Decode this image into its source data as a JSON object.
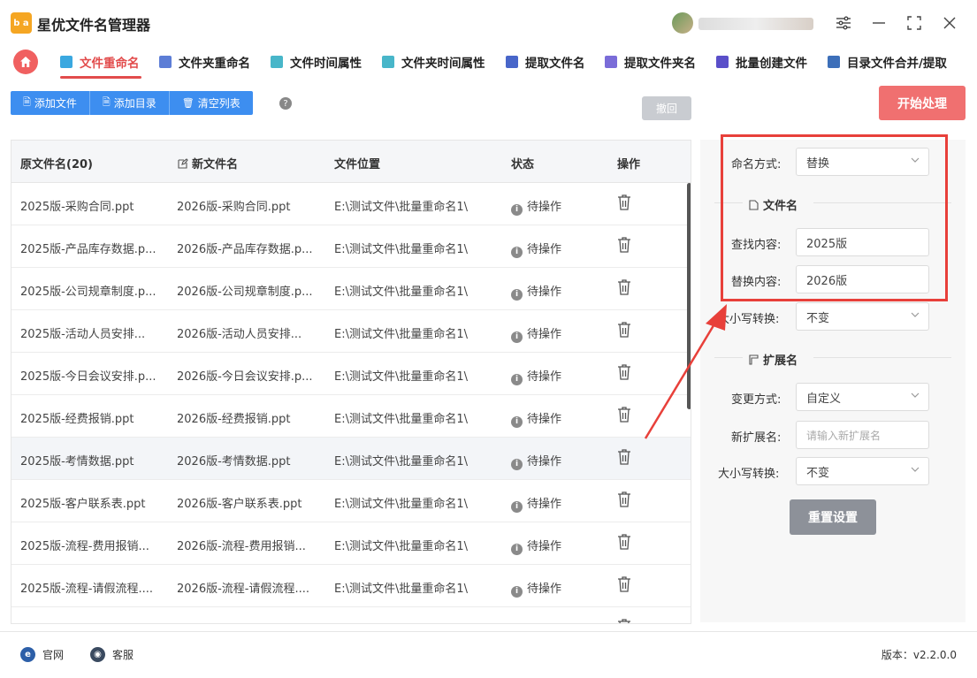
{
  "app": {
    "title": "星优文件名管理器",
    "logo_text": "b a"
  },
  "window_controls": {
    "settings": "☰",
    "minimize": "—",
    "maximize": "⛶",
    "close": "✕"
  },
  "nav": {
    "tabs": [
      {
        "label": "文件重命名",
        "active": true,
        "icon": "file-rename-icon",
        "color": "#3aa8e0"
      },
      {
        "label": "文件夹重命名",
        "active": false,
        "icon": "folder-rename-icon",
        "color": "#5c7dd6"
      },
      {
        "label": "文件时间属性",
        "active": false,
        "icon": "file-time-icon",
        "color": "#48b6c9"
      },
      {
        "label": "文件夹时间属性",
        "active": false,
        "icon": "folder-time-icon",
        "color": "#48b6c9"
      },
      {
        "label": "提取文件名",
        "active": false,
        "icon": "extract-filename-icon",
        "color": "#4866c9"
      },
      {
        "label": "提取文件夹名",
        "active": false,
        "icon": "extract-foldername-icon",
        "color": "#7a6cd8"
      },
      {
        "label": "批量创建文件",
        "active": false,
        "icon": "batch-create-icon",
        "color": "#5a4fc9"
      },
      {
        "label": "目录文件合并/提取",
        "active": false,
        "icon": "merge-extract-icon",
        "color": "#3d6fb9"
      }
    ]
  },
  "toolbar": {
    "add_file": "添加文件",
    "add_dir": "添加目录",
    "clear_list": "清空列表",
    "help": "?",
    "undo": "撤回",
    "start": "开始处理"
  },
  "table": {
    "headers": {
      "original": "原文件名(20)",
      "new": "新文件名",
      "location": "文件位置",
      "status": "状态",
      "action": "操作"
    },
    "rows": [
      {
        "original": "2025版-采购合同.ppt",
        "new": "2026版-采购合同.ppt",
        "location": "E:\\测试文件\\批量重命名1\\",
        "status": "待操作"
      },
      {
        "original": "2025版-产品库存数据.p...",
        "new": "2026版-产品库存数据.p...",
        "location": "E:\\测试文件\\批量重命名1\\",
        "status": "待操作"
      },
      {
        "original": "2025版-公司规章制度.p...",
        "new": "2026版-公司规章制度.p...",
        "location": "E:\\测试文件\\批量重命名1\\",
        "status": "待操作"
      },
      {
        "original": "2025版-活动人员安排...",
        "new": "2026版-活动人员安排...",
        "location": "E:\\测试文件\\批量重命名1\\",
        "status": "待操作"
      },
      {
        "original": "2025版-今日会议安排.p...",
        "new": "2026版-今日会议安排.p...",
        "location": "E:\\测试文件\\批量重命名1\\",
        "status": "待操作"
      },
      {
        "original": "2025版-经费报销.ppt",
        "new": "2026版-经费报销.ppt",
        "location": "E:\\测试文件\\批量重命名1\\",
        "status": "待操作"
      },
      {
        "original": "2025版-考情数据.ppt",
        "new": "2026版-考情数据.ppt",
        "location": "E:\\测试文件\\批量重命名1\\",
        "status": "待操作",
        "highlight": true
      },
      {
        "original": "2025版-客户联系表.ppt",
        "new": "2026版-客户联系表.ppt",
        "location": "E:\\测试文件\\批量重命名1\\",
        "status": "待操作"
      },
      {
        "original": "2025版-流程-费用报销...",
        "new": "2026版-流程-费用报销...",
        "location": "E:\\测试文件\\批量重命名1\\",
        "status": "待操作"
      },
      {
        "original": "2025版-流程-请假流程....",
        "new": "2026版-流程-请假流程....",
        "location": "E:\\测试文件\\批量重命名1\\",
        "status": "待操作"
      },
      {
        "original": "",
        "new": "",
        "location": "",
        "status": ""
      }
    ]
  },
  "panel": {
    "naming_mode_label": "命名方式:",
    "naming_mode_value": "替换",
    "filename_section": "文件名",
    "find_label": "查找内容:",
    "find_value": "2025版",
    "replace_label": "替换内容:",
    "replace_value": "2026版",
    "case_label": "大小写转换:",
    "case_value": "不变",
    "ext_section": "扩展名",
    "change_mode_label": "变更方式:",
    "change_mode_value": "自定义",
    "new_ext_label": "新扩展名:",
    "new_ext_placeholder": "请输入新扩展名",
    "ext_case_label": "大小写转换:",
    "ext_case_value": "不变",
    "reset": "重置设置"
  },
  "footer": {
    "website": "官网",
    "support": "客服",
    "version": "版本：v2.2.0.0"
  },
  "colors": {
    "accent_red": "#e24c4c",
    "primary_blue": "#3d8ef0",
    "annotation_red": "#e8403a"
  }
}
